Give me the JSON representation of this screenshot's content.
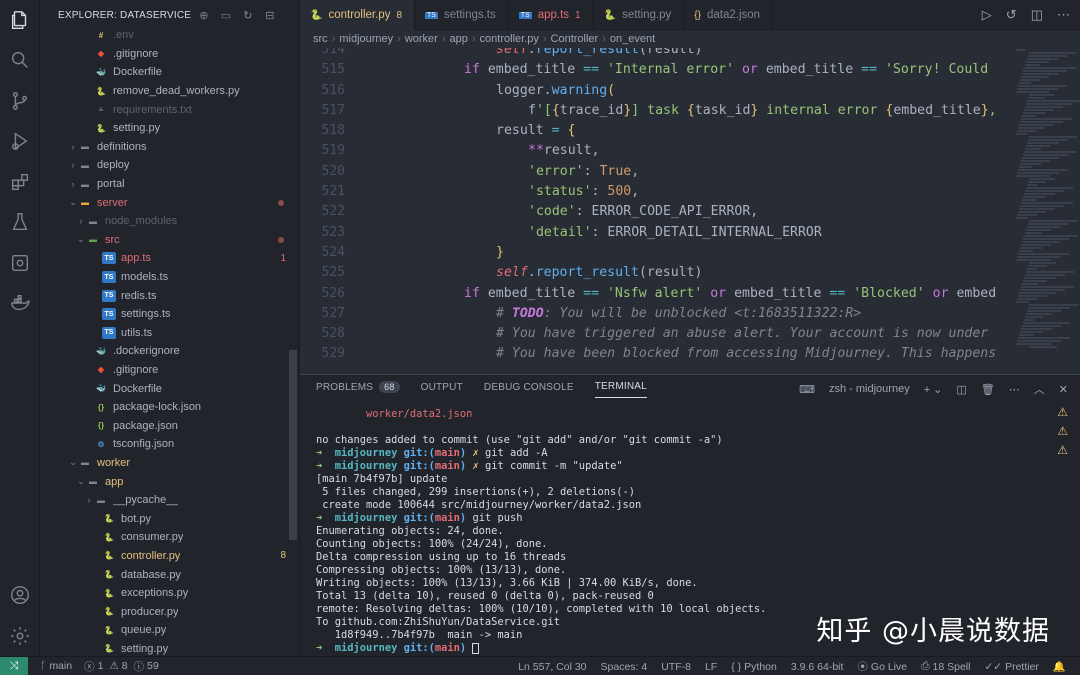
{
  "colors": {
    "accent": "#e5c07b",
    "error": "#e06c75",
    "remote": "#2d8a6e"
  },
  "sidebar": {
    "title": "EXPLORER: DATASERVICE",
    "items": [
      {
        "label": ".env",
        "icon": "env-icon",
        "indent": 4,
        "dim": true
      },
      {
        "label": ".gitignore",
        "icon": "git-icon",
        "indent": 4
      },
      {
        "label": "Dockerfile",
        "icon": "docker-icon",
        "indent": 4
      },
      {
        "label": "remove_dead_workers.py",
        "icon": "python-icon",
        "indent": 4
      },
      {
        "label": "requirements.txt",
        "icon": "text-icon",
        "indent": 4,
        "dim": true
      },
      {
        "label": "setting.py",
        "icon": "python-icon",
        "indent": 4
      },
      {
        "label": "definitions",
        "icon": "folder-icon",
        "indent": 2,
        "folder": true
      },
      {
        "label": "deploy",
        "icon": "folder-icon",
        "indent": 2,
        "folder": true
      },
      {
        "label": "portal",
        "icon": "folder-icon",
        "indent": 2,
        "folder": true
      },
      {
        "label": "server",
        "icon": "folder-icon",
        "indent": 2,
        "folder": true,
        "open": true,
        "err": true,
        "dot": true
      },
      {
        "label": "node_modules",
        "icon": "folder-icon",
        "indent": 3,
        "folder": true,
        "dim": true
      },
      {
        "label": "src",
        "icon": "folder-icon",
        "indent": 3,
        "folder": true,
        "open": true,
        "err": true,
        "dot": true
      },
      {
        "label": "app.ts",
        "icon": "ts-icon",
        "indent": 5,
        "err": true,
        "badge": "1"
      },
      {
        "label": "models.ts",
        "icon": "ts-icon",
        "indent": 5
      },
      {
        "label": "redis.ts",
        "icon": "ts-icon",
        "indent": 5
      },
      {
        "label": "settings.ts",
        "icon": "ts-icon",
        "indent": 5
      },
      {
        "label": "utils.ts",
        "icon": "ts-icon",
        "indent": 5
      },
      {
        "label": ".dockerignore",
        "icon": "docker-icon",
        "indent": 4
      },
      {
        "label": ".gitignore",
        "icon": "git-icon",
        "indent": 4
      },
      {
        "label": "Dockerfile",
        "icon": "docker-icon",
        "indent": 4
      },
      {
        "label": "package-lock.json",
        "icon": "json-icon",
        "indent": 4
      },
      {
        "label": "package.json",
        "icon": "json-icon",
        "indent": 4
      },
      {
        "label": "tsconfig.json",
        "icon": "ts-config-icon",
        "indent": 4
      },
      {
        "label": "worker",
        "icon": "folder-icon",
        "indent": 2,
        "folder": true,
        "open": true,
        "warn": true
      },
      {
        "label": "app",
        "icon": "folder-icon",
        "indent": 3,
        "folder": true,
        "open": true,
        "warn": true
      },
      {
        "label": "__pycache__",
        "icon": "folder-icon",
        "indent": 4,
        "folder": true
      },
      {
        "label": "bot.py",
        "icon": "python-icon",
        "indent": 5
      },
      {
        "label": "consumer.py",
        "icon": "python-icon",
        "indent": 5
      },
      {
        "label": "controller.py",
        "icon": "python-icon",
        "indent": 5,
        "warn": true,
        "badge": "8"
      },
      {
        "label": "database.py",
        "icon": "python-icon",
        "indent": 5
      },
      {
        "label": "exceptions.py",
        "icon": "python-icon",
        "indent": 5
      },
      {
        "label": "producer.py",
        "icon": "python-icon",
        "indent": 5
      },
      {
        "label": "queue.py",
        "icon": "python-icon",
        "indent": 5
      },
      {
        "label": "setting.py",
        "icon": "python-icon",
        "indent": 5
      }
    ]
  },
  "tabs": [
    {
      "label": "controller.py",
      "badge": "8",
      "icon": "python-icon",
      "active": true
    },
    {
      "label": "settings.ts",
      "badge": "",
      "icon": "ts-icon"
    },
    {
      "label": "app.ts",
      "badge": "1",
      "icon": "ts-icon",
      "err": true
    },
    {
      "label": "setting.py",
      "badge": "",
      "icon": "python-icon"
    },
    {
      "label": "data2.json",
      "badge": "",
      "icon": "json-icon"
    }
  ],
  "breadcrumb": [
    "src",
    "midjourney",
    "worker",
    "app",
    "controller.py",
    "Controller",
    "on_event"
  ],
  "code": {
    "line_numbers": [
      "514",
      "515",
      "516",
      "517",
      "518",
      "519",
      "520",
      "521",
      "522",
      "523",
      "524",
      "525",
      "526",
      "527",
      "528",
      "529"
    ]
  },
  "panel": {
    "tabs": [
      {
        "label": "PROBLEMS",
        "badge": "68"
      },
      {
        "label": "OUTPUT",
        "badge": ""
      },
      {
        "label": "DEBUG CONSOLE",
        "badge": ""
      },
      {
        "label": "TERMINAL",
        "badge": "",
        "active": true
      }
    ],
    "terminal_name": "zsh - midjourney",
    "terminal": {
      "l0": "        worker/data2.json",
      "l1": "",
      "l2": "no changes added to commit (use \"git add\" and/or \"git commit -a\")",
      "p1_cmd": " git add -A",
      "p2_cmd": " git commit -m \"update\"",
      "l5": "[main 7b4f97b] update",
      "l6": " 5 files changed, 299 insertions(+), 2 deletions(-)",
      "l7": " create mode 100644 src/midjourney/worker/data2.json",
      "p3_cmd": " git push",
      "l9": "Enumerating objects: 24, done.",
      "l10": "Counting objects: 100% (24/24), done.",
      "l11": "Delta compression using up to 16 threads",
      "l12": "Compressing objects: 100% (13/13), done.",
      "l13": "Writing objects: 100% (13/13), 3.66 KiB | 374.00 KiB/s, done.",
      "l14": "Total 13 (delta 10), reused 0 (delta 0), pack-reused 0",
      "l15": "remote: Resolving deltas: 100% (10/10), completed with 10 local objects.",
      "l16": "To github.com:ZhiShuYun/DataService.git",
      "l17": "   1d8f949..7b4f97b  main -> main",
      "prompt_dir": "midjourney",
      "prompt_git": "git:(",
      "prompt_branch": "main",
      "prompt_close": ")"
    },
    "watermark": "知乎 @小晨说数据"
  },
  "status": {
    "branch": "main",
    "problems": "1",
    "warnings": "8",
    "info": "59",
    "position": "Ln 557, Col 30",
    "spaces": "Spaces: 4",
    "encoding": "UTF-8",
    "eol": "LF",
    "language": "Python",
    "interpreter": "3.9.6 64-bit",
    "golive": "Go Live",
    "spell": "18 Spell",
    "prettier": "Prettier"
  }
}
